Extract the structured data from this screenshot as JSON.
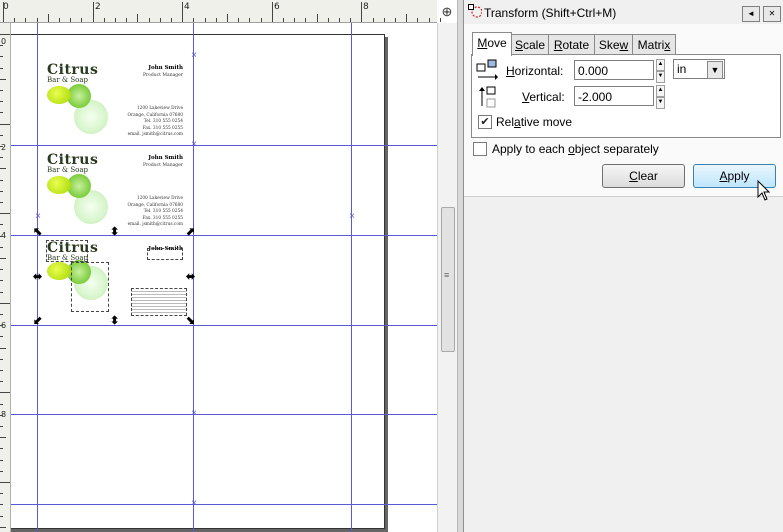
{
  "dialog": {
    "title": "Transform (Shift+Ctrl+M)",
    "tabs": [
      {
        "label": "Move",
        "mnemonic": "M",
        "rest": "ove",
        "active": true
      },
      {
        "label": "Scale",
        "mnemonic": "S",
        "rest": "cale",
        "active": false
      },
      {
        "label": "Rotate",
        "mnemonic": "R",
        "rest": "otate",
        "active": false
      },
      {
        "label": "Skew",
        "pre": "Ske",
        "mnemonic": "w",
        "active": false
      },
      {
        "label": "Matrix",
        "pre": "Matri",
        "mnemonic": "x",
        "active": false
      }
    ],
    "horizontal": {
      "label": "Horizontal:",
      "mnemonic": "H",
      "rest": "orizontal:",
      "value": "0.000"
    },
    "vertical": {
      "label": "Vertical:",
      "mnemonic": "V",
      "rest": "ertical:",
      "value": "-2.000"
    },
    "unit": "in",
    "relative_move": {
      "label": "Relative move",
      "pre": "Rel",
      "mnemonic": "a",
      "rest": "tive move",
      "checked": true
    },
    "apply_each": {
      "label": "Apply to each object separately",
      "pre": "Apply to each ",
      "mnemonic": "o",
      "rest": "bject separately",
      "checked": false
    },
    "clear_label": "Clear",
    "clear_mnemonic": "C",
    "clear_rest": "lear",
    "apply_label": "Apply",
    "apply_mnemonic": "A",
    "apply_rest": "pply",
    "header_btn1": "◄",
    "header_btn2": "✕"
  },
  "ruler": {
    "h_numbers": [
      "0",
      "2",
      "4",
      "6",
      "8"
    ],
    "v_numbers": [
      "0",
      "2",
      "4",
      "6",
      "8"
    ],
    "zoom_icon": "zoom-fit-icon"
  },
  "cards": [
    {
      "logo": "Citrus",
      "logo_sub": "Bar & Soap",
      "name": "John Smith",
      "role": "Product Manager",
      "address_lines": [
        "1200 Lakeview Drive",
        "Orange, California 07680",
        "Tel. 310 555 0254",
        "Fax. 310 555 0255",
        "email. jsmith@citrus.com"
      ]
    },
    {
      "logo": "Citrus",
      "logo_sub": "Bar & Soap",
      "name": "John Smith",
      "role": "Product Manager",
      "address_lines": [
        "1200 Lakeview Drive",
        "Orange, California 07680",
        "Tel. 310 555 0254",
        "Fax. 310 555 0255",
        "email. jsmith@citrus.com"
      ]
    },
    {
      "logo": "Citrus",
      "logo_sub": "Bar & Soap",
      "name": "John Smith",
      "selected": true
    }
  ]
}
